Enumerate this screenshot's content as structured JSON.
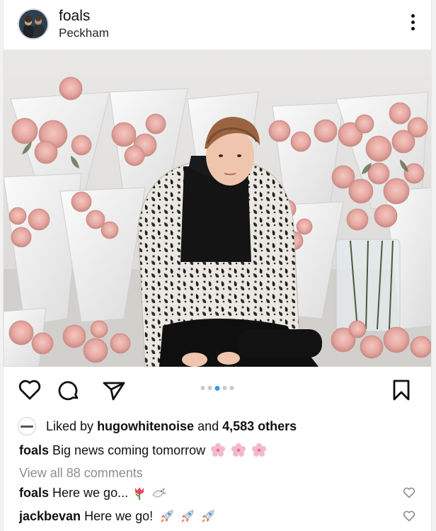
{
  "post": {
    "username": "foals",
    "location": "Peckham"
  },
  "carousel": {
    "count": 5,
    "active_index": 2
  },
  "icons": {
    "more": "more-vertical-icon",
    "like": "heart-icon",
    "comment": "comment-icon",
    "share": "send-icon",
    "save": "bookmark-icon"
  },
  "likes": {
    "prefix": "Liked by",
    "user": "hugowhitenoise",
    "connector": "and",
    "count_text": "4,583 others"
  },
  "caption": {
    "username": "foals",
    "text": "Big news coming tomorrow",
    "emojis": [
      "cherry-blossom",
      "cherry-blossom",
      "cherry-blossom"
    ]
  },
  "view_comments": "View all 88 comments",
  "comments": [
    {
      "username": "jackbevan",
      "text": "Here we go!",
      "emojis": [
        "rocket",
        "rocket",
        "rocket"
      ]
    }
  ],
  "top_comment": {
    "username": "foals",
    "text": "Here we go...",
    "emojis": [
      "tulip",
      "dove"
    ]
  },
  "colors": {
    "accent": "#3b97f0",
    "muted": "#8e8e8e"
  }
}
